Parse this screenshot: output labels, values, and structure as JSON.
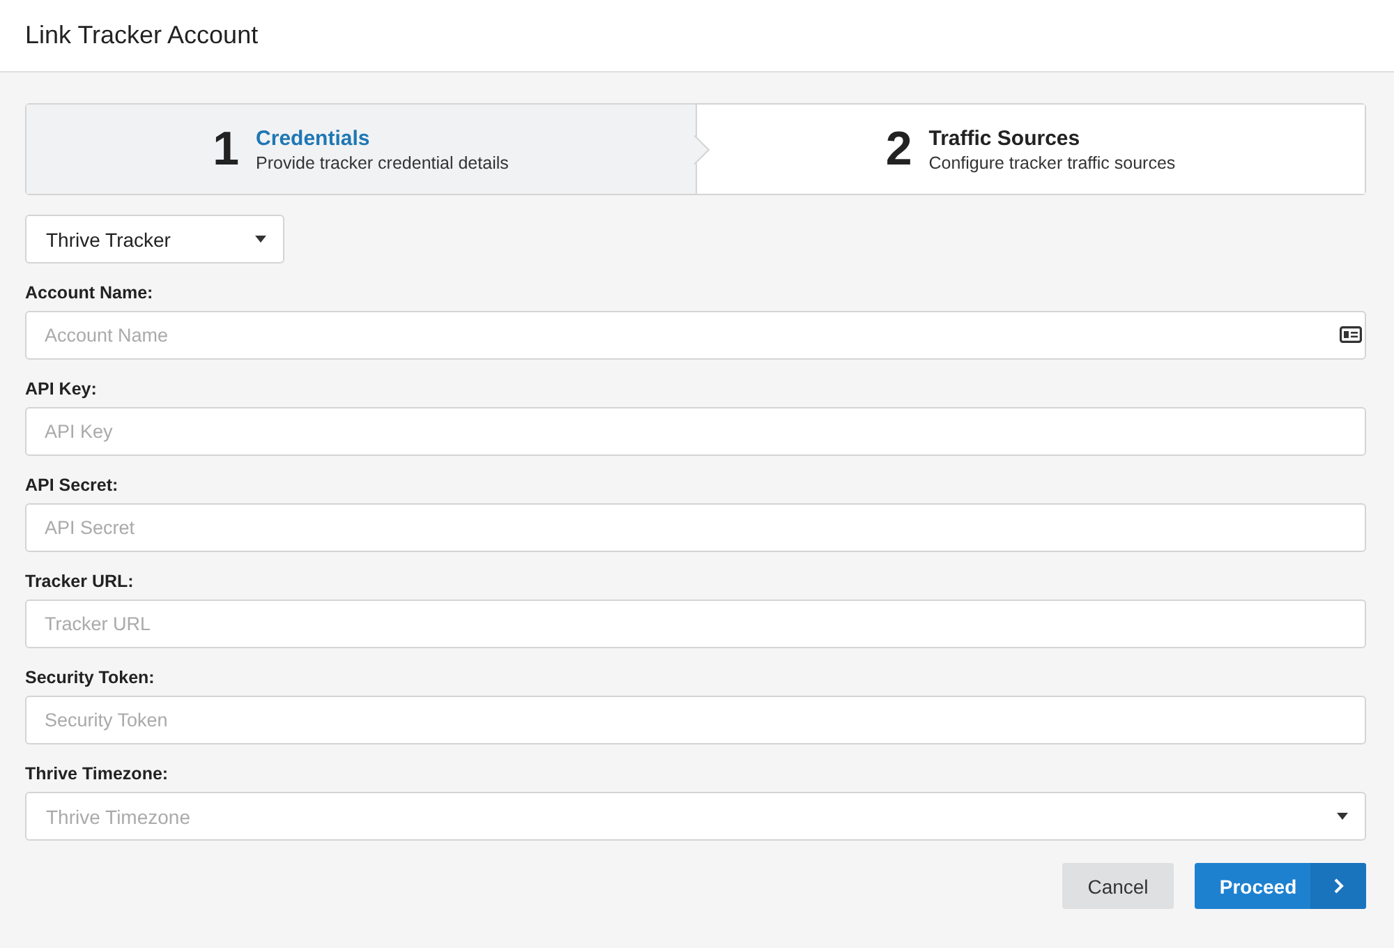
{
  "window": {
    "title": "Link Tracker Account"
  },
  "steps": [
    {
      "number": "1",
      "title": "Credentials",
      "description": "Provide tracker credential details",
      "selected": true
    },
    {
      "number": "2",
      "title": "Traffic Sources",
      "description": "Configure tracker traffic sources",
      "selected": false
    }
  ],
  "tracker_select": {
    "value": "Thrive Tracker"
  },
  "fields": [
    {
      "label": "Account Name:",
      "placeholder": "Account Name",
      "kind": "card"
    },
    {
      "label": "API Key:",
      "placeholder": "API Key",
      "kind": "text"
    },
    {
      "label": "API Secret:",
      "placeholder": "API Secret",
      "kind": "text"
    },
    {
      "label": "Tracker URL:",
      "placeholder": "Tracker URL",
      "kind": "text"
    },
    {
      "label": "Security Token:",
      "placeholder": "Security Token",
      "kind": "text"
    },
    {
      "label": "Thrive Timezone:",
      "placeholder": "Thrive Timezone",
      "kind": "select"
    }
  ],
  "buttons": [
    {
      "label": "Cancel",
      "kind": "secondary"
    },
    {
      "label": "Proceed",
      "kind": "primary"
    }
  ]
}
